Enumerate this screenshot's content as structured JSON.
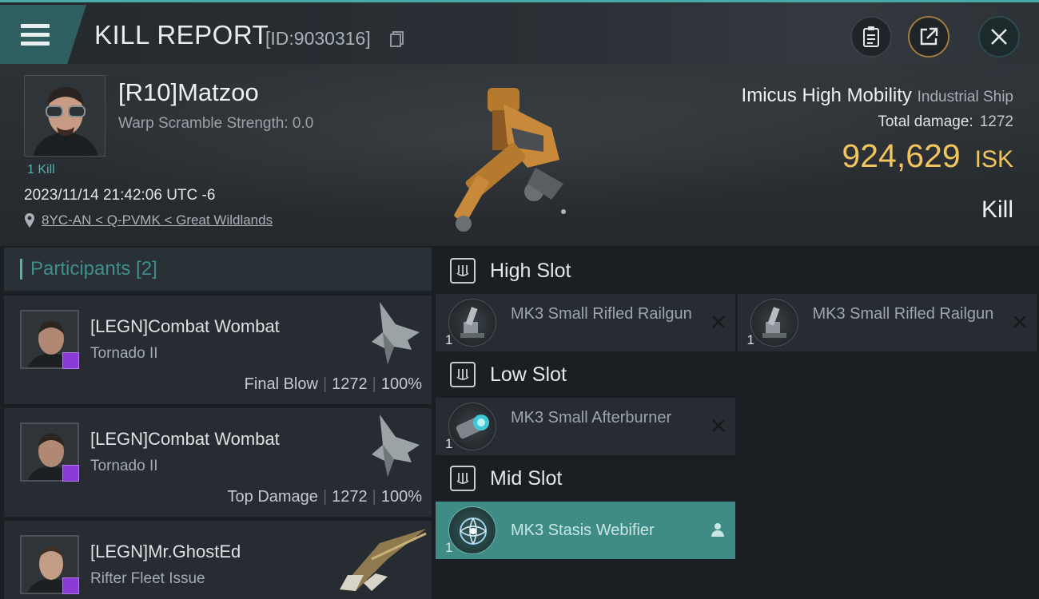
{
  "header": {
    "title": "KILL REPORT",
    "report_id": "[ID:9030316]"
  },
  "victim": {
    "name": "[R10]Matzoo",
    "warp_scramble": "Warp Scramble Strength: 0.0",
    "kills": "1 Kill",
    "datetime": "2023/11/14 21:42:06 UTC -6",
    "location": "8YC-AN < Q-PVMK < Great Wildlands",
    "ship_name": "Imicus High Mobility",
    "ship_class": "Industrial Ship",
    "total_damage_label": "Total damage:",
    "total_damage": "1272",
    "isk_value": "924,629",
    "isk_unit": "ISK",
    "result": "Kill"
  },
  "participants": {
    "header": "Participants [2]",
    "items": [
      {
        "name": "[LEGN]Combat Wombat",
        "ship": "Tornado II",
        "role": "Final Blow",
        "damage": "1272",
        "percent": "100%"
      },
      {
        "name": "[LEGN]Combat Wombat",
        "ship": "Tornado II",
        "role": "Top Damage",
        "damage": "1272",
        "percent": "100%"
      },
      {
        "name": "[LEGN]Mr.GhostEd",
        "ship": "Rifter Fleet Issue"
      }
    ]
  },
  "slots": {
    "high": {
      "title": "High Slot",
      "modules": [
        {
          "name": "MK3 Small Rifled Railgun",
          "qty": "1"
        },
        {
          "name": "MK3 Small Rifled Railgun",
          "qty": "1"
        }
      ]
    },
    "low": {
      "title": "Low Slot",
      "modules": [
        {
          "name": "MK3 Small Afterburner",
          "qty": "1"
        }
      ]
    },
    "mid": {
      "title": "Mid Slot",
      "modules": [
        {
          "name": "MK3 Stasis Webifier",
          "qty": "1"
        }
      ]
    }
  },
  "colors": {
    "accent": "#4fb4b0",
    "isk": "#f1c45e",
    "highlight": "#3f8c87",
    "badge": "#8b3cd6"
  }
}
